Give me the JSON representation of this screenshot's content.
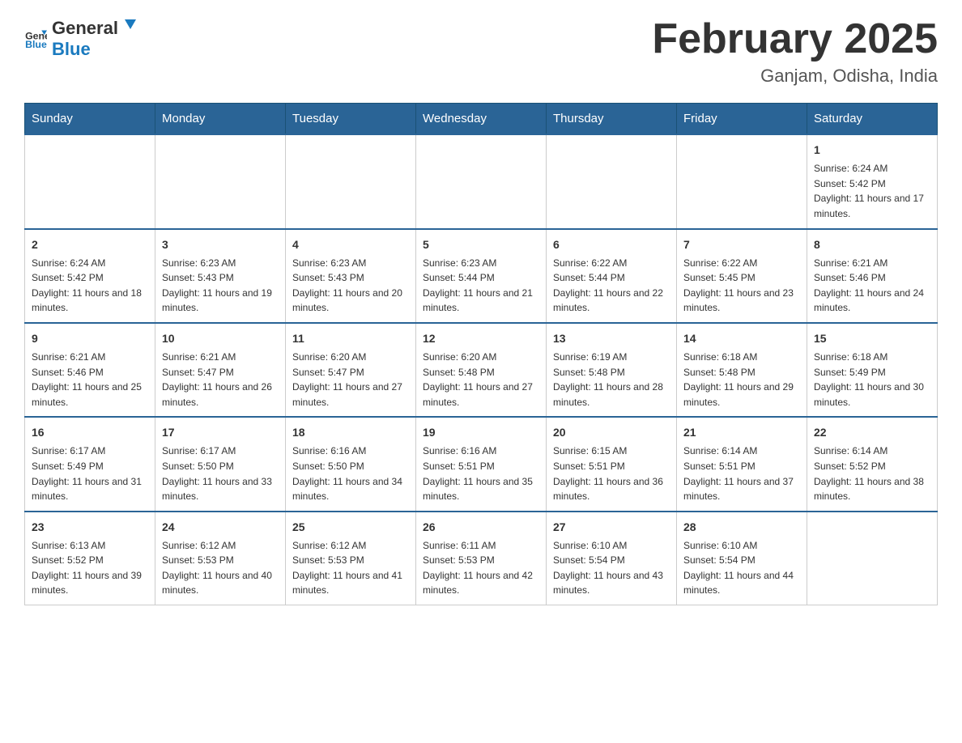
{
  "header": {
    "logo_general": "General",
    "logo_blue": "Blue",
    "month_year": "February 2025",
    "location": "Ganjam, Odisha, India"
  },
  "days_of_week": [
    "Sunday",
    "Monday",
    "Tuesday",
    "Wednesday",
    "Thursday",
    "Friday",
    "Saturday"
  ],
  "weeks": [
    [
      null,
      null,
      null,
      null,
      null,
      null,
      {
        "day": "1",
        "sunrise": "6:24 AM",
        "sunset": "5:42 PM",
        "daylight": "11 hours and 17 minutes."
      }
    ],
    [
      {
        "day": "2",
        "sunrise": "6:24 AM",
        "sunset": "5:42 PM",
        "daylight": "11 hours and 18 minutes."
      },
      {
        "day": "3",
        "sunrise": "6:23 AM",
        "sunset": "5:43 PM",
        "daylight": "11 hours and 19 minutes."
      },
      {
        "day": "4",
        "sunrise": "6:23 AM",
        "sunset": "5:43 PM",
        "daylight": "11 hours and 20 minutes."
      },
      {
        "day": "5",
        "sunrise": "6:23 AM",
        "sunset": "5:44 PM",
        "daylight": "11 hours and 21 minutes."
      },
      {
        "day": "6",
        "sunrise": "6:22 AM",
        "sunset": "5:44 PM",
        "daylight": "11 hours and 22 minutes."
      },
      {
        "day": "7",
        "sunrise": "6:22 AM",
        "sunset": "5:45 PM",
        "daylight": "11 hours and 23 minutes."
      },
      {
        "day": "8",
        "sunrise": "6:21 AM",
        "sunset": "5:46 PM",
        "daylight": "11 hours and 24 minutes."
      }
    ],
    [
      {
        "day": "9",
        "sunrise": "6:21 AM",
        "sunset": "5:46 PM",
        "daylight": "11 hours and 25 minutes."
      },
      {
        "day": "10",
        "sunrise": "6:21 AM",
        "sunset": "5:47 PM",
        "daylight": "11 hours and 26 minutes."
      },
      {
        "day": "11",
        "sunrise": "6:20 AM",
        "sunset": "5:47 PM",
        "daylight": "11 hours and 27 minutes."
      },
      {
        "day": "12",
        "sunrise": "6:20 AM",
        "sunset": "5:48 PM",
        "daylight": "11 hours and 27 minutes."
      },
      {
        "day": "13",
        "sunrise": "6:19 AM",
        "sunset": "5:48 PM",
        "daylight": "11 hours and 28 minutes."
      },
      {
        "day": "14",
        "sunrise": "6:18 AM",
        "sunset": "5:48 PM",
        "daylight": "11 hours and 29 minutes."
      },
      {
        "day": "15",
        "sunrise": "6:18 AM",
        "sunset": "5:49 PM",
        "daylight": "11 hours and 30 minutes."
      }
    ],
    [
      {
        "day": "16",
        "sunrise": "6:17 AM",
        "sunset": "5:49 PM",
        "daylight": "11 hours and 31 minutes."
      },
      {
        "day": "17",
        "sunrise": "6:17 AM",
        "sunset": "5:50 PM",
        "daylight": "11 hours and 33 minutes."
      },
      {
        "day": "18",
        "sunrise": "6:16 AM",
        "sunset": "5:50 PM",
        "daylight": "11 hours and 34 minutes."
      },
      {
        "day": "19",
        "sunrise": "6:16 AM",
        "sunset": "5:51 PM",
        "daylight": "11 hours and 35 minutes."
      },
      {
        "day": "20",
        "sunrise": "6:15 AM",
        "sunset": "5:51 PM",
        "daylight": "11 hours and 36 minutes."
      },
      {
        "day": "21",
        "sunrise": "6:14 AM",
        "sunset": "5:51 PM",
        "daylight": "11 hours and 37 minutes."
      },
      {
        "day": "22",
        "sunrise": "6:14 AM",
        "sunset": "5:52 PM",
        "daylight": "11 hours and 38 minutes."
      }
    ],
    [
      {
        "day": "23",
        "sunrise": "6:13 AM",
        "sunset": "5:52 PM",
        "daylight": "11 hours and 39 minutes."
      },
      {
        "day": "24",
        "sunrise": "6:12 AM",
        "sunset": "5:53 PM",
        "daylight": "11 hours and 40 minutes."
      },
      {
        "day": "25",
        "sunrise": "6:12 AM",
        "sunset": "5:53 PM",
        "daylight": "11 hours and 41 minutes."
      },
      {
        "day": "26",
        "sunrise": "6:11 AM",
        "sunset": "5:53 PM",
        "daylight": "11 hours and 42 minutes."
      },
      {
        "day": "27",
        "sunrise": "6:10 AM",
        "sunset": "5:54 PM",
        "daylight": "11 hours and 43 minutes."
      },
      {
        "day": "28",
        "sunrise": "6:10 AM",
        "sunset": "5:54 PM",
        "daylight": "11 hours and 44 minutes."
      },
      null
    ]
  ]
}
